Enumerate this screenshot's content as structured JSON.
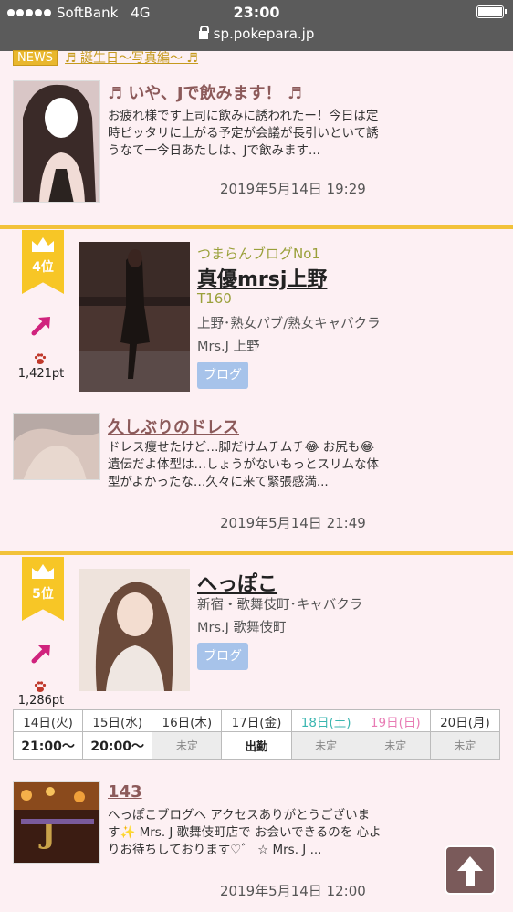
{
  "status_bar": {
    "carrier": "SoftBank",
    "network": "4G",
    "time": "23:00",
    "url": "sp.pokepara.jp"
  },
  "news": {
    "badge": "NEWS",
    "link_text": "♬ 誕生日〜写真編〜 ♬"
  },
  "entries": [
    {
      "title": "♬ いや、Jで飲みます！ ♬",
      "body": "お疲れ様です上司に飲みに誘われたー！今日は定時ピッタリに上がる予定が会議が長引いといて誘うなて一今日あたしは、Jで飲みます...",
      "date": "2019年5月14日 19:29"
    },
    {
      "title": "久しぶりのドレス",
      "body": "ドレス痩せたけど…脚だけムチムチ😂 お尻も😂 遺伝だよ体型は…しょうがないもっとスリムな体型がよかったな…久々に来て緊張感満...",
      "date": "2019年5月14日 21:49"
    },
    {
      "title": "143",
      "body": "へっぽこブログへ アクセスありがとうございます✨ Mrs. J 歌舞伎町店で お会いできるのを 心よりお待ちしております♡゛ ☆ Mrs. J ...",
      "date": "2019年5月14日 12:00"
    }
  ],
  "ranks": [
    {
      "rank": "4位",
      "points": "1,421pt",
      "tagline": "つまらんブログNo1",
      "name": "真優mrsj上野",
      "height": "T160",
      "area": "上野･熟女パブ/熟女キャバクラ",
      "shop": "Mrs.J 上野",
      "blog_label": "ブログ"
    },
    {
      "rank": "5位",
      "points": "1,286pt",
      "name": "へっぽこ",
      "area": "新宿・歌舞伎町･キャバクラ",
      "shop": "Mrs.J 歌舞伎町",
      "blog_label": "ブログ"
    }
  ],
  "schedule": {
    "days": [
      "14日(火)",
      "15日(水)",
      "16日(木)",
      "17日(金)",
      "18日(土)",
      "19日(日)",
      "20日(月)"
    ],
    "values": [
      "21:00〜",
      "20:00〜",
      "未定",
      "出勤",
      "未定",
      "未定",
      "未定"
    ]
  },
  "colors": {
    "background": "#fdf0f3",
    "accent_gold": "#f2c23a",
    "title_brown": "#8c5a5a",
    "blog_button": "#a7c3ea",
    "saturday": "#3ab6b0",
    "sunday": "#e87bb4"
  },
  "icons": [
    "crown-icon",
    "trend-up-arrow-icon",
    "paw-icon",
    "lock-icon",
    "battery-icon",
    "arrow-up-icon"
  ]
}
